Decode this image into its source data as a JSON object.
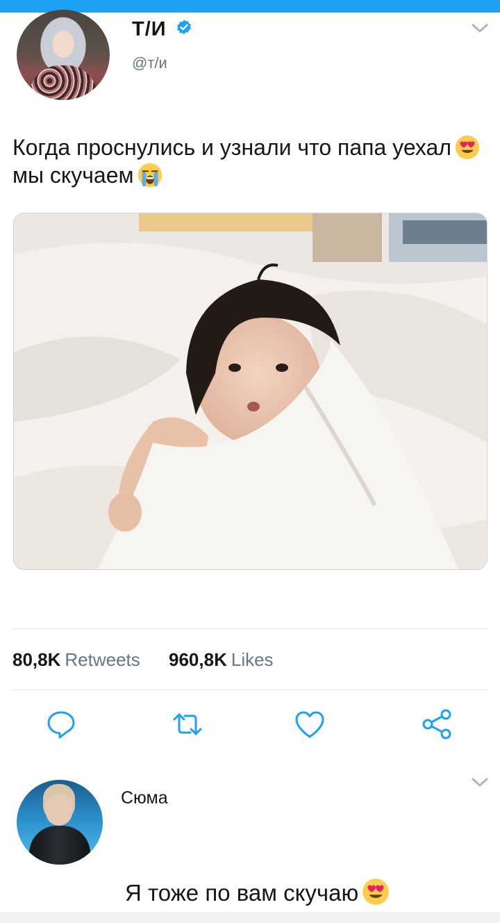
{
  "colors": {
    "accent": "#1da1f2",
    "muted": "#657786",
    "icon": "#1da1f2"
  },
  "tweet": {
    "author_name": "Т/И",
    "handle": "@т/и",
    "verified": true,
    "text_part1": "Когда проснулись и узнали что папа уехал",
    "emoji1": "heart-eyes-emoji",
    "text_part2": "мы скучаем",
    "emoji2": "loudly-crying-emoji",
    "media_alt_icon": "photo"
  },
  "stats": {
    "retweets_count": "80,8K",
    "retweets_label": "Retweets",
    "likes_count": "960,8K",
    "likes_label": "Likes"
  },
  "actions": [
    {
      "name": "reply",
      "icon": "speech-bubble-icon"
    },
    {
      "name": "retweet",
      "icon": "retweet-icon"
    },
    {
      "name": "like",
      "icon": "heart-icon"
    },
    {
      "name": "share",
      "icon": "share-icon"
    }
  ],
  "reply": {
    "author_name": "Сюма",
    "text": "Я тоже по вам скучаю",
    "emoji": "heart-eyes-emoji"
  }
}
